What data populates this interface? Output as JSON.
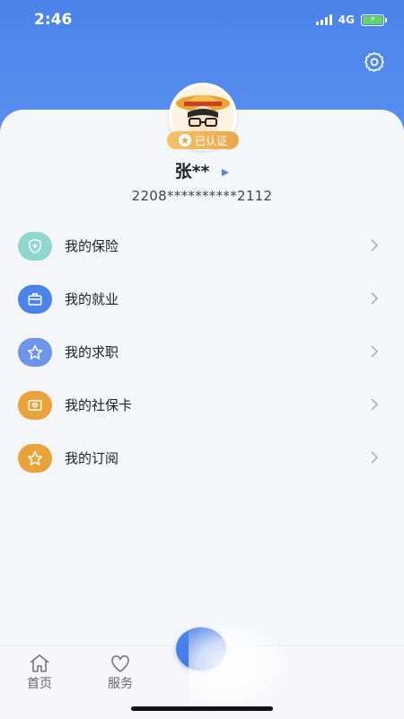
{
  "status_bar": {
    "time": "2:46",
    "network": "4G"
  },
  "header": {
    "settings_icon": "gear-icon"
  },
  "profile": {
    "avatar_icon": "cartoon-avatar",
    "verified_label": "已认证",
    "name": "张**",
    "id_number": "2208**********2112"
  },
  "menu": {
    "items": [
      {
        "label": "我的保险",
        "icon": "shield-plus-icon",
        "color": "#8fd6cf"
      },
      {
        "label": "我的就业",
        "icon": "briefcase-icon",
        "color": "#4b83ea"
      },
      {
        "label": "我的求职",
        "icon": "star-icon",
        "color": "#6f95ea"
      },
      {
        "label": "我的社保卡",
        "icon": "card-heart-icon",
        "color": "#e9a33a"
      },
      {
        "label": "我的订阅",
        "icon": "star-icon",
        "color": "#e9a33a"
      }
    ]
  },
  "bottom_nav": {
    "items": [
      {
        "label": "首页",
        "icon": "home-icon"
      },
      {
        "label": "服务",
        "icon": "heart-icon"
      }
    ]
  },
  "colors": {
    "primary": "#4b83ea",
    "badge": "#eeb35a",
    "background": "#f5f6fa"
  }
}
